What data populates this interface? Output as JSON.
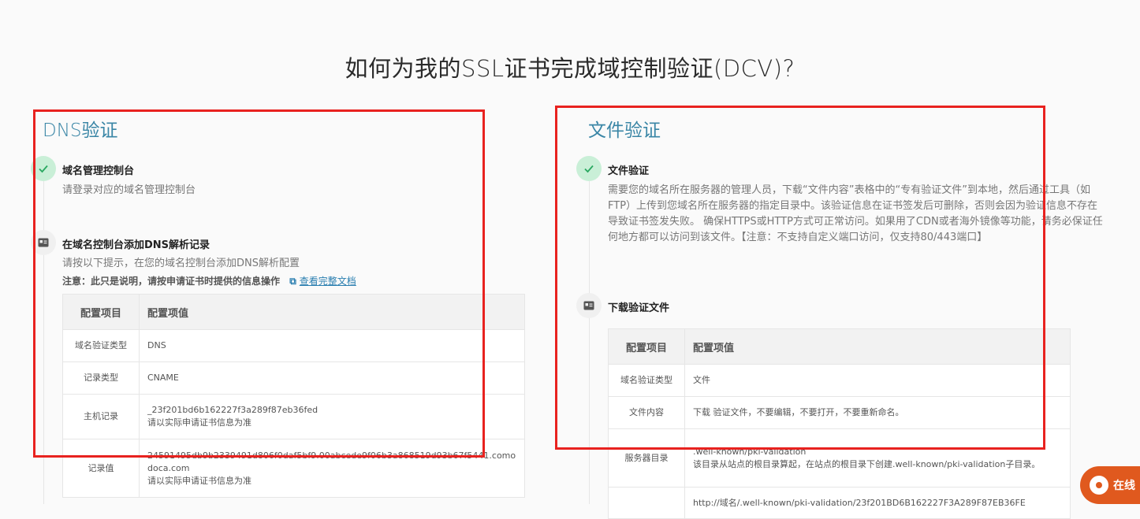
{
  "page": {
    "title": "如何为我的SSL证书完成域控制验证(DCV)?"
  },
  "dns": {
    "title": "DNS验证",
    "step1": {
      "title": "域名管理控制台",
      "desc": "请登录对应的域名管理控制台"
    },
    "step2": {
      "title": "在域名控制台添加DNS解析记录",
      "desc": "请按以下提示，在您的域名控制台添加DNS解析配置",
      "note": "注意：此只是说明，请按申请证书时提供的信息操作",
      "link": "查看完整文档"
    },
    "table": {
      "headers": [
        "配置项目",
        "配置项值"
      ],
      "rows": [
        {
          "key": "域名验证类型",
          "value": "DNS",
          "sub": ""
        },
        {
          "key": "记录类型",
          "value": "CNAME",
          "sub": ""
        },
        {
          "key": "主机记录",
          "value": "_23f201bd6b162227f3a289f87eb36fed",
          "sub": "请以实际申请证书信息为准"
        },
        {
          "key": "记录值",
          "value": "24591495db9b2339491d806f0daf5bf9.00abcede9f06b3a868519d93b67f5441.comodoca.com",
          "sub": "请以实际申请证书信息为准"
        }
      ]
    }
  },
  "file": {
    "title": "文件验证",
    "step1": {
      "title": "文件验证",
      "desc": "需要您的域名所在服务器的管理人员，下载“文件内容”表格中的“专有验证文件”到本地，然后通过工具（如FTP）上传到您域名所在服务器的指定目录中。该验证信息在证书签发后可删除，否则会因为验证信息不存在导致证书签发失败。 确保HTTPS或HTTP方式可正常访问。如果用了CDN或者海外镜像等功能，请务必保证任何地方都可以访问到该文件。【注意：不支持自定义端口访问，仅支持80/443端口】"
    },
    "step2": {
      "title": "下载验证文件"
    },
    "table": {
      "headers": [
        "配置项目",
        "配置项值"
      ],
      "rows": [
        {
          "key": "域名验证类型",
          "value": "文件",
          "sub": ""
        },
        {
          "key": "文件内容",
          "value": "下载 验证文件，不要编辑，不要打开，不要重新命名。",
          "sub": ""
        },
        {
          "key": "服务器目录",
          "value": ".well-known/pki-validation",
          "sub": "该目录从站点的根目录算起，在站点的根目录下创建.well-known/pki-validation子目录。"
        },
        {
          "key": "",
          "value": "http://域名/.well-known/pki-validation/23f201BD6B162227F3A289F87EB36FE",
          "sub": ""
        }
      ]
    }
  },
  "chat": {
    "label": "在线"
  },
  "colors": {
    "accent": "#3a86a6",
    "highlight": "#e8221f",
    "check_bg": "#c9efd7",
    "chat": "#e0591e"
  }
}
